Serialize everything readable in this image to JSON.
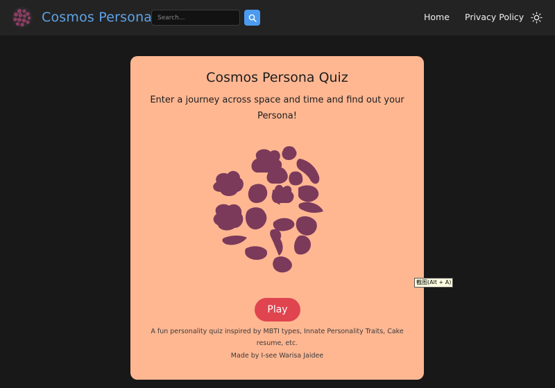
{
  "navbar": {
    "brand_name": "Cosmos Persona",
    "search": {
      "placeholder": "Search...",
      "value": ""
    },
    "links": [
      {
        "label": "Home"
      },
      {
        "label": "Privacy Policy"
      }
    ]
  },
  "card": {
    "title": "Cosmos Persona Quiz",
    "subtitle": "Enter a journey across space and time and find out your Persona!",
    "play_label": "Play",
    "description": "A fun personality quiz inspired by MBTI types, Innate Personality Traits, Cake resume, etc.",
    "credit": "Made by I-see Warisa Jaidee"
  },
  "tooltip": {
    "text": "截图(Alt + A)"
  },
  "colors": {
    "accent": "#5fa4e9",
    "card_bg": "#ffb792",
    "play": "#e0444f",
    "illustration": "#7b3a5a",
    "page_bg": "#181818",
    "navbar_bg": "#232323"
  },
  "icons": {
    "logo": "persona-cluster-logo",
    "search": "search-icon",
    "theme": "sun-icon"
  }
}
